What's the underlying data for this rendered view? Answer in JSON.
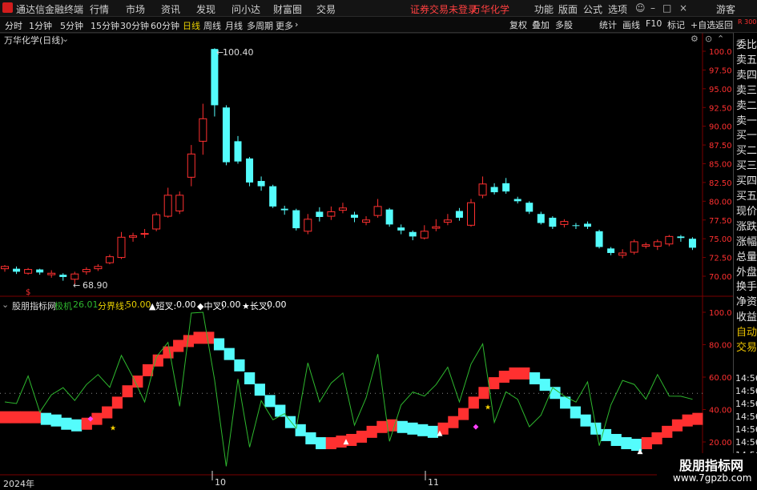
{
  "topbar": {
    "app_title": "通达信金融终端",
    "menus": [
      "行情",
      "市场",
      "资讯",
      "发现",
      "问小达",
      "财富圈",
      "交易"
    ],
    "login_status": "证券交易未登录",
    "stock_name": "万华化学",
    "right_menus": [
      "功能",
      "版面",
      "公式",
      "选项"
    ],
    "guest": "游客"
  },
  "periods": [
    "分时",
    "1分钟",
    "5分钟",
    "15分钟",
    "30分钟",
    "60分钟",
    "日线",
    "周线",
    "月线",
    "多周期",
    "更多"
  ],
  "selected_period": "日线",
  "right_tools": [
    "复权",
    "叠加",
    "多股",
    "统计",
    "画线",
    "F10",
    "标记",
    "+自选",
    "返回"
  ],
  "main_chart": {
    "title": "万华化学(日线)",
    "high_label": "100.40",
    "low_label": "68.90",
    "y_ticks": [
      "100.0",
      "97.50",
      "95.00",
      "92.50",
      "90.00",
      "87.50",
      "85.00",
      "82.50",
      "80.00",
      "77.50",
      "75.00",
      "72.50",
      "70.00"
    ],
    "right_corner": "R 300"
  },
  "indicator": {
    "name": "股朋指标网",
    "label_1": "极机",
    "value_1": "26.01",
    "label_2": "分界线:",
    "value_2": "50.00",
    "cross_short": "▲短叉:",
    "cross_short_val": "0.00",
    "cross_mid": "◆中叉:",
    "cross_mid_val": "0.00",
    "cross_long": "★长叉:",
    "cross_long_val": "0.00",
    "y_ticks": [
      "100.0",
      "80.00",
      "60.00",
      "40.00",
      "20.00"
    ]
  },
  "x_axis": {
    "labels": [
      "2024年",
      "10",
      "11"
    ]
  },
  "side_labels": [
    "委比",
    "卖五",
    "卖四",
    "卖三",
    "卖二",
    "卖一",
    "买一",
    "买二",
    "买三",
    "买四",
    "买五",
    "现价",
    "涨跌",
    "涨幅",
    "总量",
    "外盘",
    "换手",
    "净资",
    "收益",
    "自动",
    "交易"
  ],
  "side_times": [
    "14:56",
    "14:56",
    "14:56",
    "14:56",
    "14:56",
    "14:56",
    "14:56",
    "14:56"
  ],
  "watermark": {
    "title": "股朋指标网",
    "url": "www.7gpzb.com"
  },
  "colors": {
    "up": "#ff3030",
    "down": "#54fcfc",
    "grid": "#7a0000",
    "text": "#d0d0d0",
    "yellow": "#e8d000",
    "green": "#2eb82e"
  },
  "chart_data": {
    "type": "candlestick",
    "candles": [
      {
        "o": 71.0,
        "c": 71.3,
        "h": 71.5,
        "l": 70.6
      },
      {
        "o": 71.0,
        "c": 70.6,
        "h": 71.3,
        "l": 70.3
      },
      {
        "o": 70.4,
        "c": 70.9,
        "h": 71.1,
        "l": 70.2
      },
      {
        "o": 70.9,
        "c": 70.5,
        "h": 71.0,
        "l": 70.2
      },
      {
        "o": 70.2,
        "c": 70.4,
        "h": 70.8,
        "l": 69.8
      },
      {
        "o": 70.2,
        "c": 69.9,
        "h": 70.4,
        "l": 69.4
      },
      {
        "o": 69.6,
        "c": 70.3,
        "h": 70.6,
        "l": 68.9
      },
      {
        "o": 70.6,
        "c": 70.9,
        "h": 71.2,
        "l": 70.2
      },
      {
        "o": 71.0,
        "c": 71.3,
        "h": 71.6,
        "l": 70.7
      },
      {
        "o": 71.8,
        "c": 72.6,
        "h": 72.9,
        "l": 71.6
      },
      {
        "o": 72.5,
        "c": 75.2,
        "h": 75.9,
        "l": 72.3
      },
      {
        "o": 75.2,
        "c": 75.4,
        "h": 75.8,
        "l": 74.6
      },
      {
        "o": 75.6,
        "c": 75.7,
        "h": 76.3,
        "l": 75.1
      },
      {
        "o": 76.3,
        "c": 78.2,
        "h": 78.5,
        "l": 76.0
      },
      {
        "o": 78.0,
        "c": 80.8,
        "h": 81.8,
        "l": 77.8
      },
      {
        "o": 78.7,
        "c": 80.8,
        "h": 81.3,
        "l": 78.3
      },
      {
        "o": 83.2,
        "c": 86.3,
        "h": 87.5,
        "l": 82.0
      },
      {
        "o": 88.0,
        "c": 91.0,
        "h": 93.0,
        "l": 86.2
      },
      {
        "o": 100.3,
        "c": 92.8,
        "h": 100.4,
        "l": 91.3
      },
      {
        "o": 92.5,
        "c": 85.2,
        "h": 92.8,
        "l": 84.8
      },
      {
        "o": 88.0,
        "c": 85.3,
        "h": 88.7,
        "l": 85.0
      },
      {
        "o": 85.7,
        "c": 82.5,
        "h": 85.9,
        "l": 82.0
      },
      {
        "o": 82.7,
        "c": 82.0,
        "h": 83.3,
        "l": 81.4
      },
      {
        "o": 82.0,
        "c": 79.3,
        "h": 82.2,
        "l": 79.1
      },
      {
        "o": 79.0,
        "c": 78.8,
        "h": 79.4,
        "l": 78.2
      },
      {
        "o": 78.8,
        "c": 76.4,
        "h": 79.0,
        "l": 76.1
      },
      {
        "o": 76.0,
        "c": 77.6,
        "h": 78.3,
        "l": 75.6
      },
      {
        "o": 78.6,
        "c": 77.9,
        "h": 79.2,
        "l": 77.3
      },
      {
        "o": 78.0,
        "c": 78.6,
        "h": 79.3,
        "l": 77.5
      },
      {
        "o": 78.8,
        "c": 79.1,
        "h": 79.8,
        "l": 78.4
      },
      {
        "o": 78.2,
        "c": 77.8,
        "h": 78.6,
        "l": 77.2
      },
      {
        "o": 77.2,
        "c": 77.5,
        "h": 78.0,
        "l": 76.8
      },
      {
        "o": 78.1,
        "c": 79.3,
        "h": 80.3,
        "l": 77.8
      },
      {
        "o": 78.9,
        "c": 76.9,
        "h": 79.1,
        "l": 76.6
      },
      {
        "o": 76.5,
        "c": 76.1,
        "h": 76.9,
        "l": 75.6
      },
      {
        "o": 75.9,
        "c": 75.3,
        "h": 76.1,
        "l": 74.8
      },
      {
        "o": 75.1,
        "c": 76.0,
        "h": 76.8,
        "l": 74.9
      },
      {
        "o": 76.4,
        "c": 76.6,
        "h": 77.6,
        "l": 76.0
      },
      {
        "o": 77.2,
        "c": 77.5,
        "h": 78.3,
        "l": 76.8
      },
      {
        "o": 78.7,
        "c": 77.8,
        "h": 79.1,
        "l": 77.4
      },
      {
        "o": 76.8,
        "c": 79.8,
        "h": 80.3,
        "l": 76.6
      },
      {
        "o": 80.8,
        "c": 82.3,
        "h": 83.3,
        "l": 80.4
      },
      {
        "o": 81.9,
        "c": 81.2,
        "h": 82.4,
        "l": 80.9
      },
      {
        "o": 82.4,
        "c": 81.3,
        "h": 83.1,
        "l": 81.0
      },
      {
        "o": 80.3,
        "c": 80.0,
        "h": 80.6,
        "l": 79.7
      },
      {
        "o": 79.8,
        "c": 78.6,
        "h": 80.0,
        "l": 78.3
      },
      {
        "o": 78.3,
        "c": 77.1,
        "h": 78.6,
        "l": 76.9
      },
      {
        "o": 77.8,
        "c": 76.6,
        "h": 78.0,
        "l": 76.3
      },
      {
        "o": 76.9,
        "c": 77.3,
        "h": 77.6,
        "l": 76.5
      },
      {
        "o": 76.8,
        "c": 76.7,
        "h": 77.1,
        "l": 76.3
      },
      {
        "o": 77.0,
        "c": 76.6,
        "h": 77.3,
        "l": 76.3
      },
      {
        "o": 76.0,
        "c": 73.9,
        "h": 76.2,
        "l": 73.7
      },
      {
        "o": 73.7,
        "c": 73.1,
        "h": 73.9,
        "l": 72.8
      },
      {
        "o": 72.8,
        "c": 73.1,
        "h": 73.6,
        "l": 72.4
      },
      {
        "o": 73.2,
        "c": 74.6,
        "h": 74.9,
        "l": 72.9
      },
      {
        "o": 74.0,
        "c": 74.2,
        "h": 74.5,
        "l": 73.7
      },
      {
        "o": 74.0,
        "c": 74.6,
        "h": 74.9,
        "l": 73.5
      },
      {
        "o": 74.3,
        "c": 75.3,
        "h": 75.5,
        "l": 74.0
      },
      {
        "o": 75.3,
        "c": 75.1,
        "h": 75.5,
        "l": 74.6
      },
      {
        "o": 75.0,
        "c": 73.8,
        "h": 75.2,
        "l": 73.5
      }
    ],
    "indicator_band": [
      35,
      35,
      35,
      35,
      34,
      33,
      31,
      30,
      31,
      34,
      38,
      44,
      51,
      57,
      64,
      70,
      75,
      79,
      82,
      84,
      84,
      80,
      74,
      67,
      59,
      52,
      45,
      39,
      32,
      27,
      22,
      19,
      19,
      20,
      21,
      23,
      26,
      29,
      30,
      29,
      28,
      27,
      26,
      28,
      32,
      37,
      44,
      50,
      56,
      60,
      62,
      62,
      59,
      55,
      50,
      44,
      38,
      33,
      28,
      24,
      21,
      19,
      18,
      19,
      22,
      26,
      30,
      33,
      34
    ]
  }
}
